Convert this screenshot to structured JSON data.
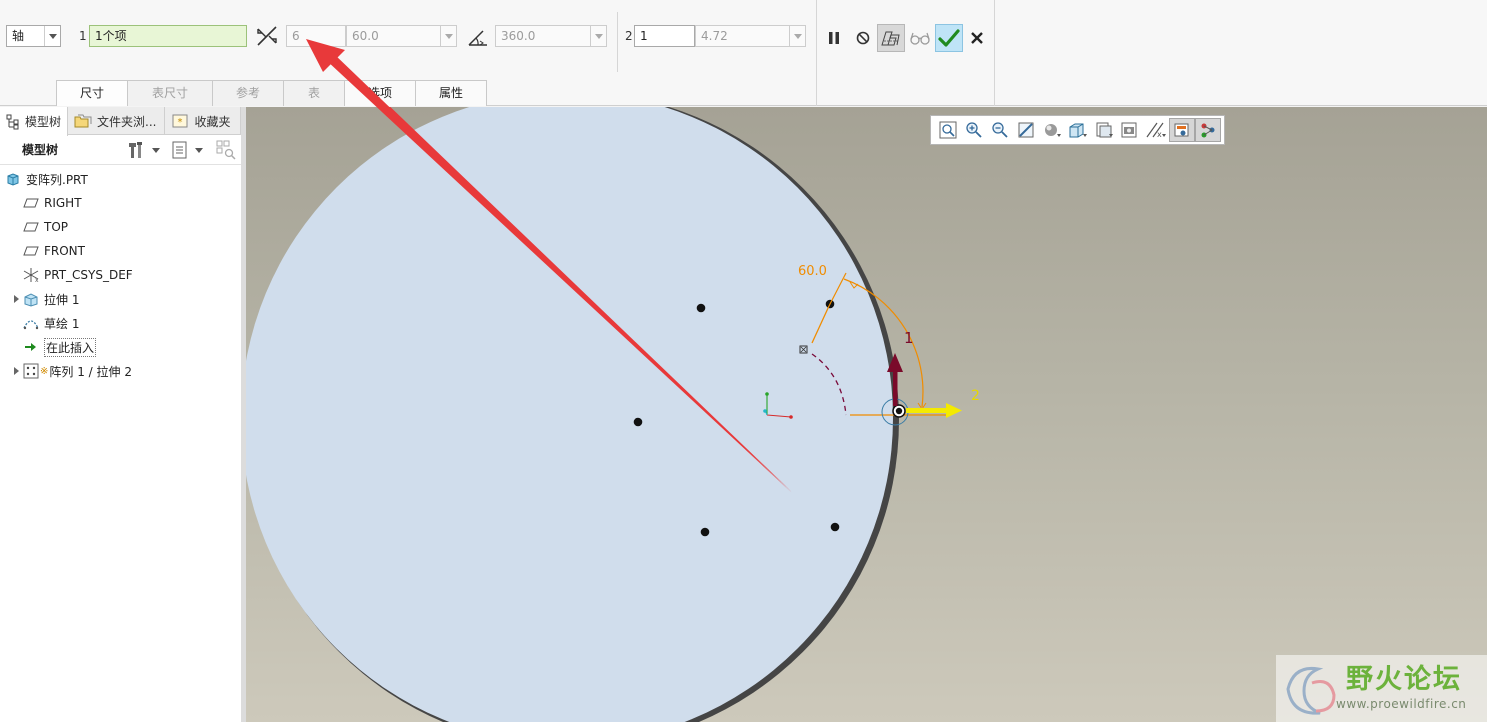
{
  "dashboard": {
    "pattern_type": "轴",
    "dir1_label": "1",
    "dir1_ref": "1个项",
    "member_count": "6",
    "member_angle": "60.0",
    "angular_extent": "360.0",
    "dir2_label": "2",
    "dir2_count": "1",
    "dir2_spacing": "4.72"
  },
  "tabs": [
    {
      "label": "尺寸",
      "state": "active"
    },
    {
      "label": "表尺寸",
      "state": "disabled"
    },
    {
      "label": "参考",
      "state": "disabled"
    },
    {
      "label": "表",
      "state": "disabled"
    },
    {
      "label": "选项",
      "state": "normal"
    },
    {
      "label": "属性",
      "state": "normal"
    }
  ],
  "navigator": {
    "tabs": [
      {
        "label": "模型树",
        "icon": "model-tree-icon"
      },
      {
        "label": "文件夹浏...",
        "icon": "folder-browser-icon"
      },
      {
        "label": "收藏夹",
        "icon": "favorites-icon"
      }
    ],
    "tree_title": "模型树",
    "nodes": [
      {
        "label": "变阵列.PRT",
        "icon": "part-icon",
        "expander": false,
        "indent": 0
      },
      {
        "label": "RIGHT",
        "icon": "datum-plane-icon",
        "expander": false,
        "indent": 1
      },
      {
        "label": "TOP",
        "icon": "datum-plane-icon",
        "expander": false,
        "indent": 1
      },
      {
        "label": "FRONT",
        "icon": "datum-plane-icon",
        "expander": false,
        "indent": 1
      },
      {
        "label": "PRT_CSYS_DEF",
        "icon": "csys-icon",
        "expander": false,
        "indent": 1
      },
      {
        "label": "拉伸 1",
        "icon": "extrude-icon",
        "expander": true,
        "indent": 1
      },
      {
        "label": "草绘 1",
        "icon": "sketch-icon",
        "expander": false,
        "indent": 1
      },
      {
        "label": "在此插入",
        "icon": "insert-here-icon",
        "expander": false,
        "indent": 1
      },
      {
        "label": "阵列 1 / 拉伸 2",
        "icon": "pattern-icon",
        "expander": true,
        "indent": 1
      }
    ]
  },
  "scene": {
    "dim_angle": "60.0",
    "dir1_tag": "1",
    "dir2_tag": "2"
  },
  "colors": {
    "disk": "#d0ddec",
    "dim": "#f08c00",
    "arrow": "#e8393a",
    "dir1": "#7a0a2a",
    "dir2": "#f4ea00"
  },
  "watermark": {
    "title": "野火论坛",
    "url": "www.proewildfire.cn"
  }
}
